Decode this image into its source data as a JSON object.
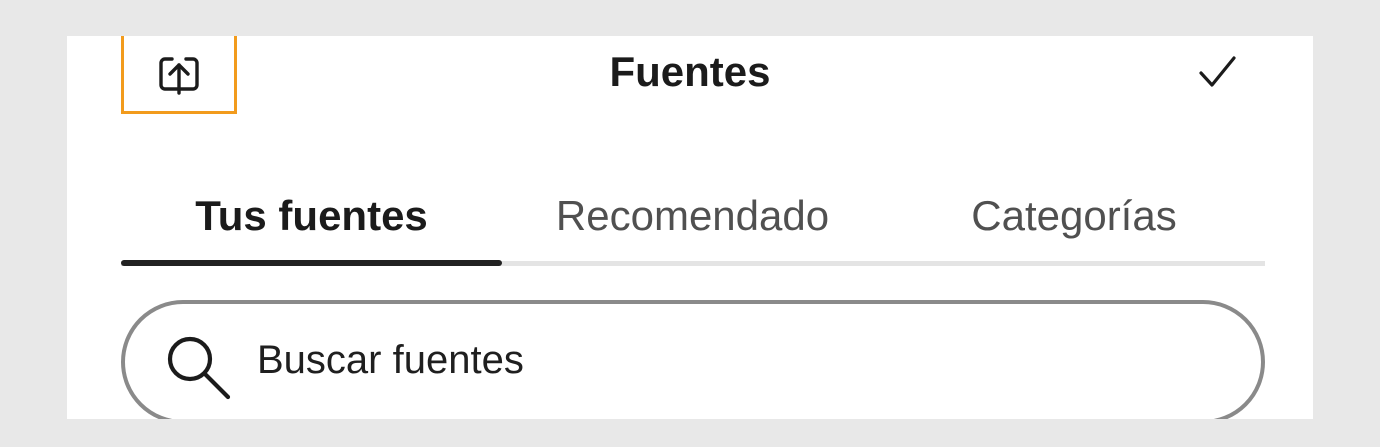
{
  "header": {
    "title": "Fuentes",
    "share_icon": "share-upload-icon",
    "done_icon": "checkmark-icon"
  },
  "tabs": [
    {
      "label": "Tus fuentes",
      "active": true
    },
    {
      "label": "Recomendado",
      "active": false
    },
    {
      "label": "Categorías",
      "active": false
    }
  ],
  "search": {
    "placeholder": "Buscar fuentes",
    "value": "",
    "icon": "search-icon"
  },
  "colors": {
    "highlight": "#f29b1d",
    "active_tab_indicator": "#222222",
    "background": "#e8e8e8",
    "panel": "#ffffff"
  }
}
